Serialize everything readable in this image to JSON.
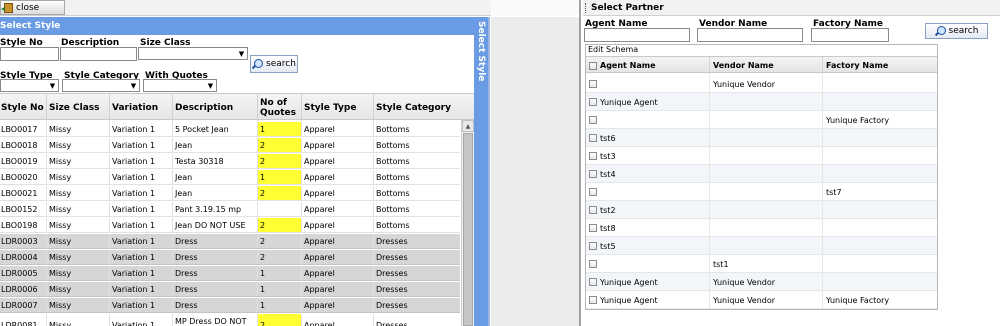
{
  "topbar": {
    "close_label": "close"
  },
  "style_panel": {
    "title": "Select Style",
    "vertical_tab_label": "Select Style",
    "filters": {
      "style_no_label": "Style No",
      "description_label": "Description",
      "size_class_label": "Size Class",
      "style_type_label": "Style Type",
      "style_category_label": "Style Category",
      "with_quotes_label": "With Quotes",
      "search_label": "search"
    },
    "columns": [
      "Style No",
      "Size Class",
      "Variation",
      "Description",
      "No of Quotes",
      "Style Type",
      "Style Category"
    ],
    "rows": [
      {
        "style_no": "LBO0017",
        "size_class": "Missy",
        "variation": "Variation 1",
        "description": "5 Pocket Jean",
        "quotes": "1",
        "style_type": "Apparel",
        "category": "Bottoms",
        "highlight": true,
        "gray": false
      },
      {
        "style_no": "LBO0018",
        "size_class": "Missy",
        "variation": "Variation 1",
        "description": "Jean",
        "quotes": "2",
        "style_type": "Apparel",
        "category": "Bottoms",
        "highlight": true,
        "gray": false
      },
      {
        "style_no": "LBO0019",
        "size_class": "Missy",
        "variation": "Variation 1",
        "description": "Testa 30318",
        "quotes": "2",
        "style_type": "Apparel",
        "category": "Bottoms",
        "highlight": true,
        "gray": false
      },
      {
        "style_no": "LBO0020",
        "size_class": "Missy",
        "variation": "Variation 1",
        "description": "Jean",
        "quotes": "1",
        "style_type": "Apparel",
        "category": "Bottoms",
        "highlight": true,
        "gray": false
      },
      {
        "style_no": "LBO0021",
        "size_class": "Missy",
        "variation": "Variation 1",
        "description": "Jean",
        "quotes": "2",
        "style_type": "Apparel",
        "category": "Bottoms",
        "highlight": true,
        "gray": false
      },
      {
        "style_no": "LBO0152",
        "size_class": "Missy",
        "variation": "Variation 1",
        "description": "Pant 3.19.15 mp",
        "quotes": "",
        "style_type": "Apparel",
        "category": "Bottoms",
        "highlight": false,
        "gray": false
      },
      {
        "style_no": "LBO0198",
        "size_class": "Missy",
        "variation": "Variation 1",
        "description": "Jean DO NOT USE",
        "quotes": "2",
        "style_type": "Apparel",
        "category": "Bottoms",
        "highlight": true,
        "gray": false
      },
      {
        "style_no": "LDR0003",
        "size_class": "Missy",
        "variation": "Variation 1",
        "description": "Dress",
        "quotes": "2",
        "style_type": "Apparel",
        "category": "Dresses",
        "highlight": false,
        "gray": true
      },
      {
        "style_no": "LDR0004",
        "size_class": "Missy",
        "variation": "Variation 1",
        "description": "Dress",
        "quotes": "2",
        "style_type": "Apparel",
        "category": "Dresses",
        "highlight": false,
        "gray": true
      },
      {
        "style_no": "LDR0005",
        "size_class": "Missy",
        "variation": "Variation 1",
        "description": "Dress",
        "quotes": "1",
        "style_type": "Apparel",
        "category": "Dresses",
        "highlight": false,
        "gray": true
      },
      {
        "style_no": "LDR0006",
        "size_class": "Missy",
        "variation": "Variation 1",
        "description": "Dress",
        "quotes": "1",
        "style_type": "Apparel",
        "category": "Dresses",
        "highlight": false,
        "gray": true
      },
      {
        "style_no": "LDR0007",
        "size_class": "Missy",
        "variation": "Variation 1",
        "description": "Dress",
        "quotes": "1",
        "style_type": "Apparel",
        "category": "Dresses",
        "highlight": false,
        "gray": true
      },
      {
        "style_no": "LDR0081",
        "size_class": "Missy",
        "variation": "Variation 1",
        "description": "MP Dress DO NOT USE",
        "quotes": "2",
        "style_type": "Apparel",
        "category": "Dresses",
        "highlight": true,
        "gray": false
      }
    ]
  },
  "partner_panel": {
    "title": "Select Partner",
    "filters": {
      "agent_label": "Agent Name",
      "vendor_label": "Vendor Name",
      "factory_label": "Factory Name",
      "search_label": "search"
    },
    "schema_title": "Edit Schema",
    "columns": [
      "Agent Name",
      "Vendor Name",
      "Factory Name"
    ],
    "rows": [
      {
        "agent": "",
        "vendor": "Yunique Vendor",
        "factory": ""
      },
      {
        "agent": "Yunique Agent",
        "vendor": "",
        "factory": ""
      },
      {
        "agent": "",
        "vendor": "",
        "factory": "Yunique Factory"
      },
      {
        "agent": "tst6",
        "vendor": "",
        "factory": ""
      },
      {
        "agent": "tst3",
        "vendor": "",
        "factory": ""
      },
      {
        "agent": "tst4",
        "vendor": "",
        "factory": ""
      },
      {
        "agent": "",
        "vendor": "",
        "factory": "tst7"
      },
      {
        "agent": "tst2",
        "vendor": "",
        "factory": ""
      },
      {
        "agent": "tst8",
        "vendor": "",
        "factory": ""
      },
      {
        "agent": "tst5",
        "vendor": "",
        "factory": ""
      },
      {
        "agent": "",
        "vendor": "tst1",
        "factory": ""
      },
      {
        "agent": "Yunique Agent",
        "vendor": "Yunique Vendor",
        "factory": ""
      },
      {
        "agent": "Yunique Agent",
        "vendor": "Yunique Vendor",
        "factory": "Yunique Factory"
      }
    ]
  },
  "colors": {
    "header_blue": "#6a9ce6",
    "highlight_yellow": "#ffff33",
    "gray_row": "#d6d6d6"
  }
}
